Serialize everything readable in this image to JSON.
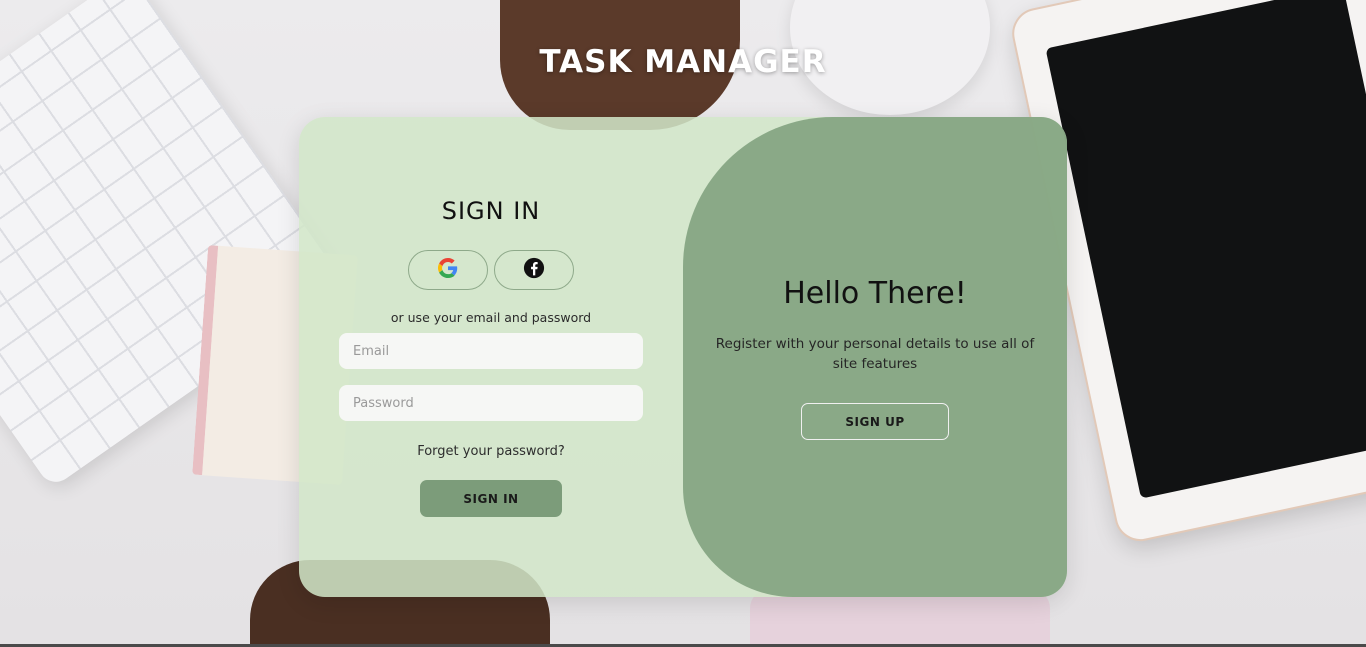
{
  "app": {
    "title": "TASK MANAGER"
  },
  "signin": {
    "title": "SIGN IN",
    "social": [
      {
        "name": "google",
        "icon": "google-icon"
      },
      {
        "name": "facebook",
        "icon": "facebook-icon"
      }
    ],
    "or_text": "or use your email and password",
    "email_placeholder": "Email",
    "email_value": "",
    "password_placeholder": "Password",
    "password_value": "",
    "forgot_label": "Forget your password?",
    "button_label": "SIGN IN"
  },
  "signup": {
    "title": "Hello There!",
    "subtitle": "Register with your personal details to use all of site features",
    "button_label": "SIGN UP"
  },
  "colors": {
    "card_left": "#d2e6c8",
    "card_right": "#80a07d",
    "signin_button": "#7c9c7a",
    "title_text": "#ffffff"
  }
}
